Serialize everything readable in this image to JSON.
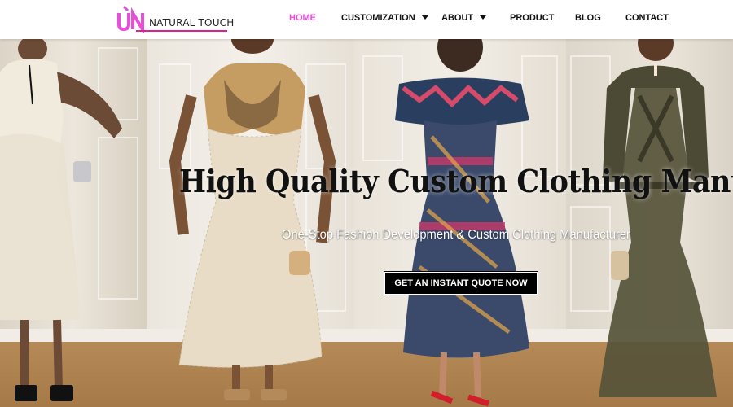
{
  "brand": {
    "mark": "ŰN",
    "name": "NATURAL TOUCH",
    "accent": "#e0208d",
    "mark_color": "#e64fd8"
  },
  "nav": {
    "items": [
      {
        "label": "HOME",
        "active": true
      },
      {
        "label": "CUSTOMIZATION",
        "dropdown": true
      },
      {
        "label": "ABOUT",
        "dropdown": true
      },
      {
        "label": "PRODUCT"
      },
      {
        "label": "BLOG"
      },
      {
        "label": "CONTACT"
      }
    ]
  },
  "hero": {
    "title": "High Quality Custom Clothing Manufacture",
    "subtitle": "One-Stop Fashion Development & Custom Clothing Manufacturer",
    "cta_label": "GET AN INSTANT QUOTE NOW"
  }
}
